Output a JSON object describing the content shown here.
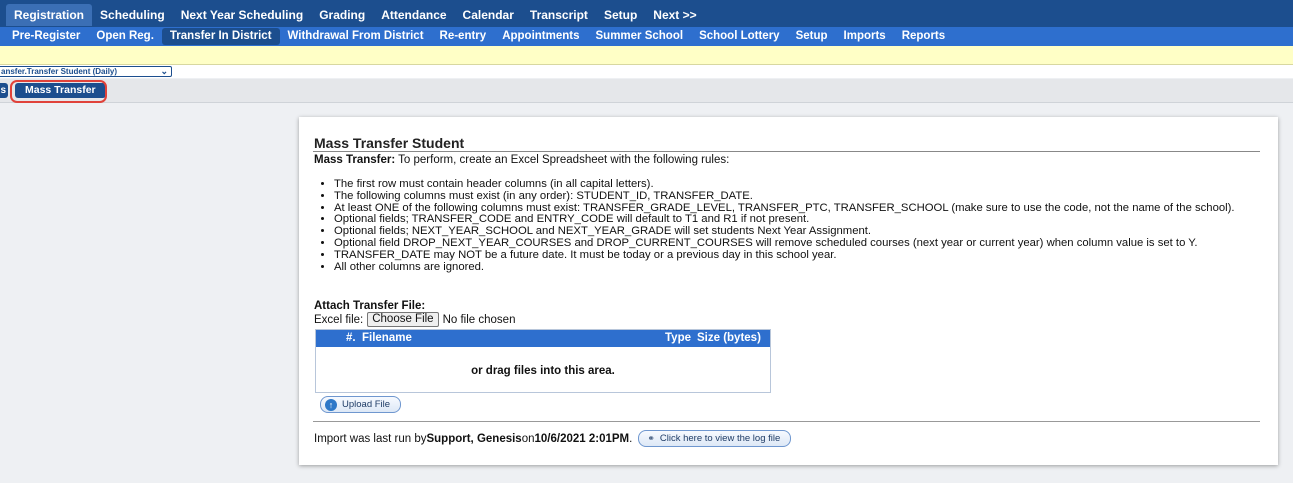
{
  "top_nav": {
    "items": [
      "Registration",
      "Scheduling",
      "Next Year Scheduling",
      "Grading",
      "Attendance",
      "Calendar",
      "Transcript",
      "Setup",
      "Next >>"
    ],
    "active": "Registration"
  },
  "sub_nav": {
    "items": [
      "Pre-Register",
      "Open Reg.",
      "Transfer In District",
      "Withdrawal From District",
      "Re-entry",
      "Appointments",
      "Summer School",
      "School Lottery",
      "Setup",
      "Imports",
      "Reports"
    ],
    "active": "Transfer In District"
  },
  "report_select": {
    "value": "ansfer.Transfer Student (Daily)",
    "icon": "chevron-down-icon"
  },
  "tabs": {
    "partial_label": "s",
    "active_label": "Mass Transfer"
  },
  "panel": {
    "title": "Mass Transfer Student",
    "intro_bold": "Mass Transfer:",
    "intro_text": " To perform, create an Excel Spreadsheet with the following rules:",
    "rules": [
      "The first row must contain header columns (in all capital letters).",
      "The following columns must exist (in any order): STUDENT_ID, TRANSFER_DATE.",
      "At least ONE of the following columns must exist: TRANSFER_GRADE_LEVEL, TRANSFER_PTC, TRANSFER_SCHOOL (make sure to use the code, not the name of the school).",
      "Optional fields; TRANSFER_CODE and ENTRY_CODE will default to T1 and R1 if not present.",
      "Optional fields; NEXT_YEAR_SCHOOL and NEXT_YEAR_GRADE will set students Next Year Assignment.",
      "Optional field DROP_NEXT_YEAR_COURSES and DROP_CURRENT_COURSES will remove scheduled courses (next year or current year) when column value is set to Y.",
      "TRANSFER_DATE may NOT be a future date. It must be today or a previous day in this school year.",
      "All other columns are ignored."
    ],
    "attach_label": "Attach Transfer File:",
    "excel_label": "Excel file:",
    "choose_button": "Choose File",
    "file_status": "No file chosen",
    "upload_table": {
      "col_num": "#.",
      "col_filename": "Filename",
      "col_type": "Type",
      "col_size": "Size (bytes)",
      "drag_text": "or drag files into this area."
    },
    "upload_button": "Upload File",
    "import_text_prefix": "Import was last run by ",
    "import_user": "Support, Genesis",
    "import_on": " on ",
    "import_datetime": "10/6/2021 2:01PM",
    "import_period": ".",
    "log_button": "Click here to view the log file"
  }
}
